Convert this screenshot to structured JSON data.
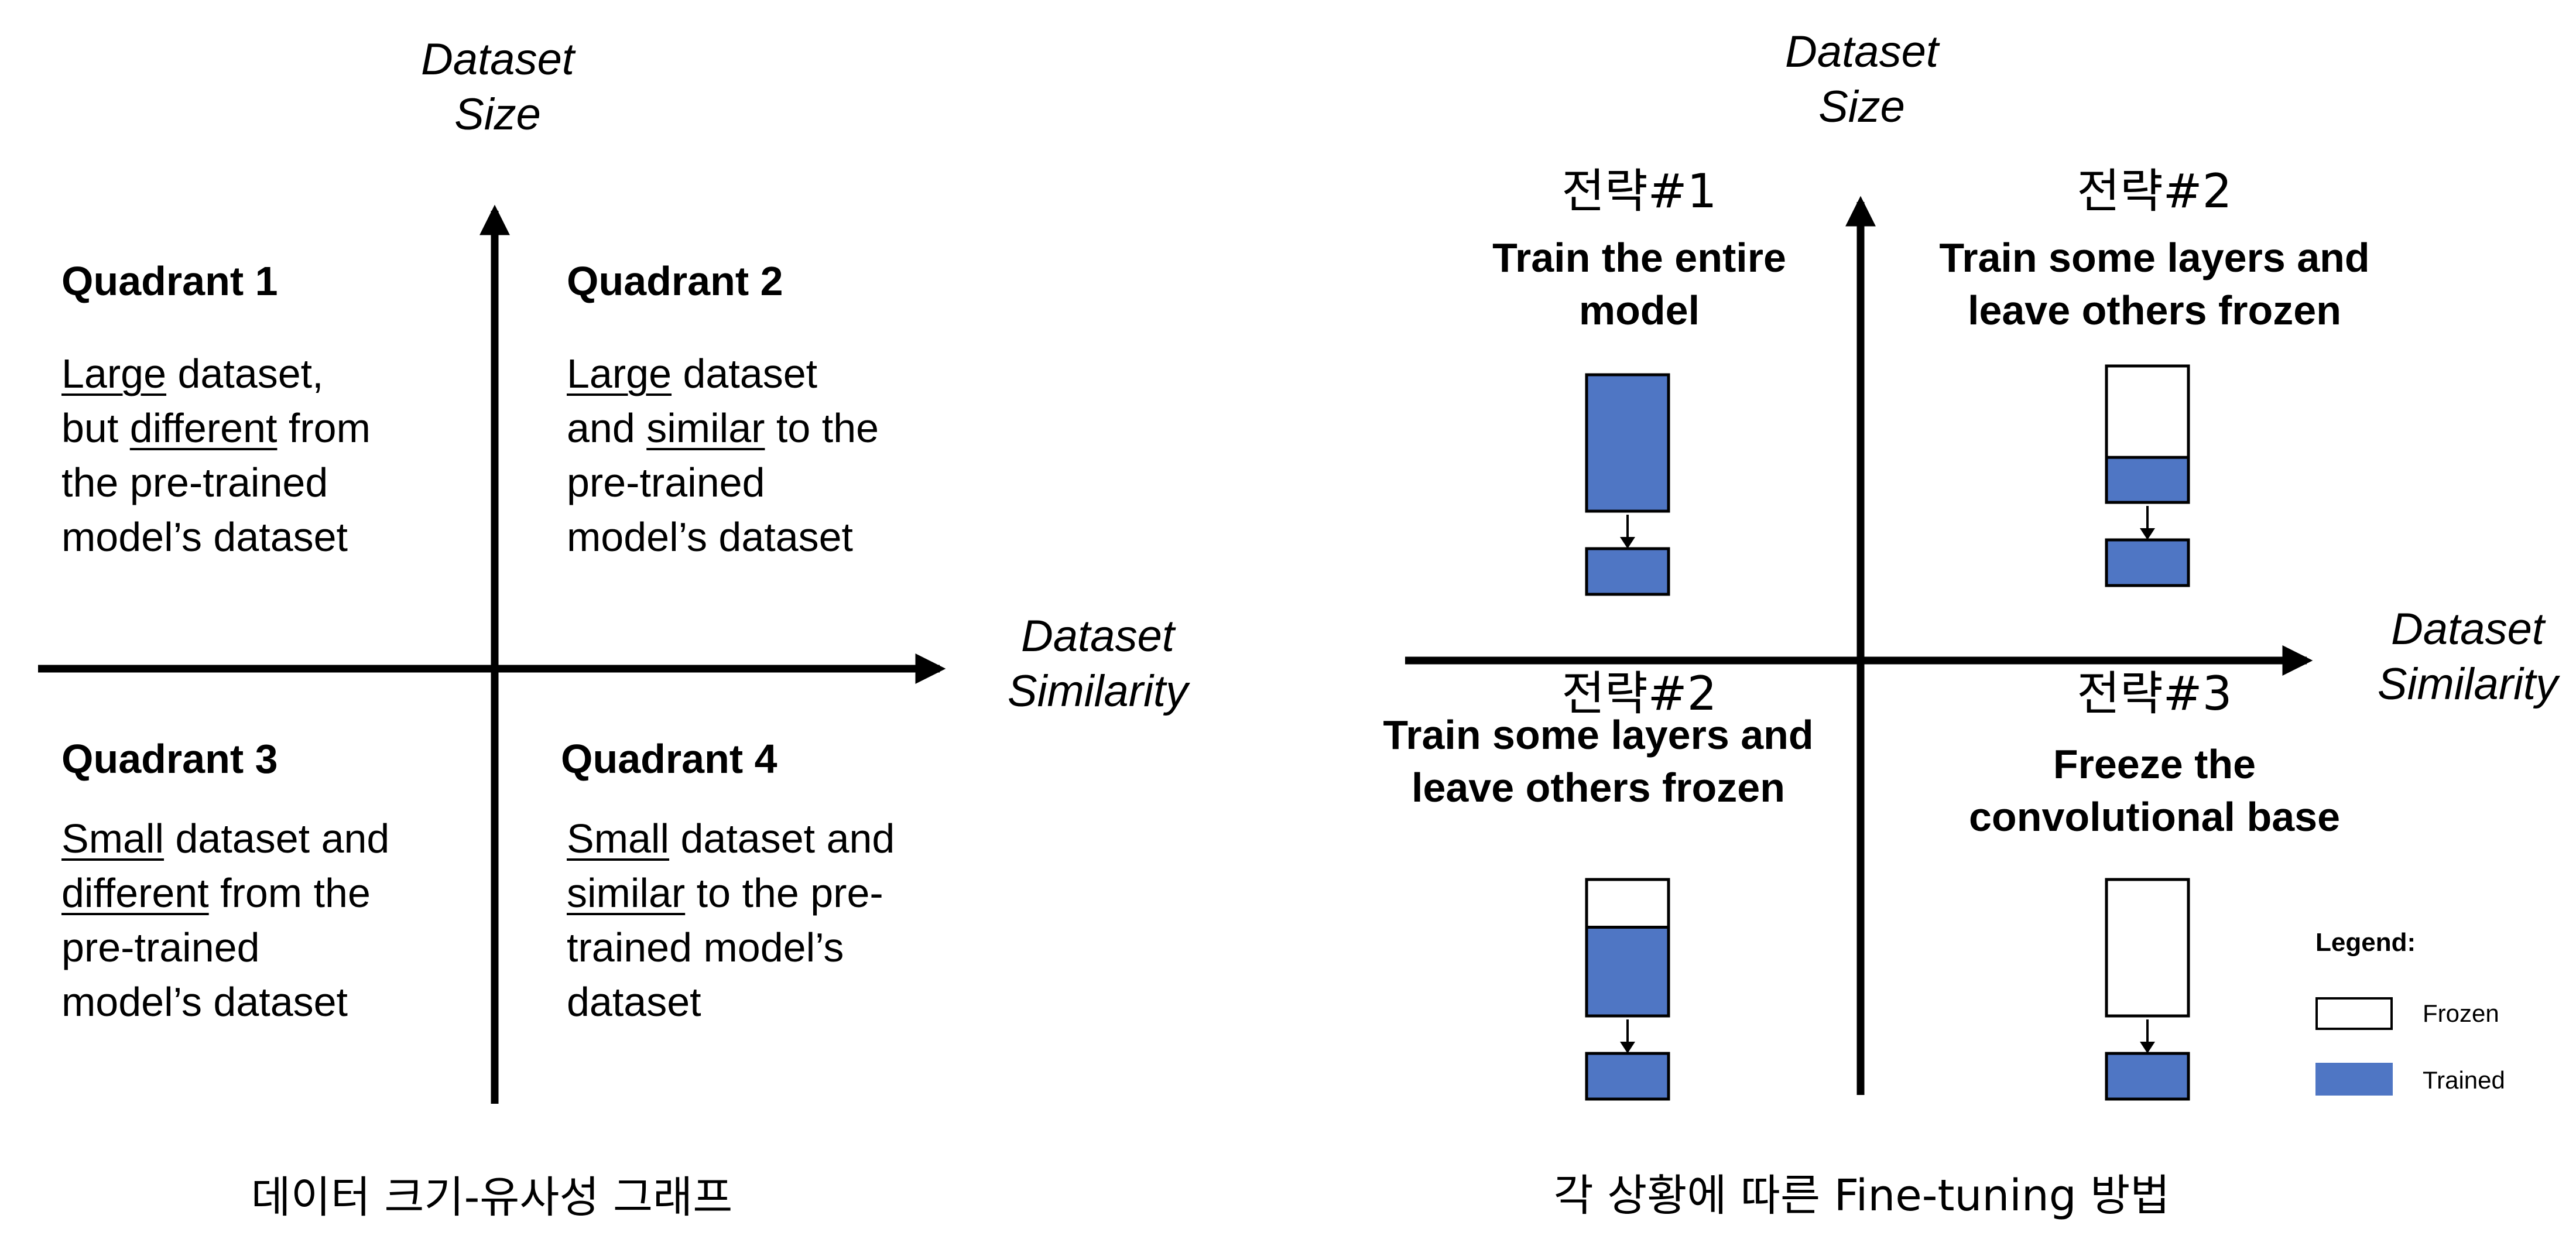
{
  "left_panel": {
    "y_axis_label": [
      "Dataset",
      "Size"
    ],
    "x_axis_label": [
      "Dataset",
      "Similarity"
    ],
    "quadrants": [
      {
        "title": "Quadrant 1",
        "lines": [
          [
            {
              "t": "Large",
              "u": true
            },
            {
              "t": " dataset,"
            }
          ],
          [
            {
              "t": "but "
            },
            {
              "t": "different",
              "u": true
            },
            {
              "t": " from"
            }
          ],
          [
            {
              "t": "the pre-trained"
            }
          ],
          [
            {
              "t": "model’s dataset"
            }
          ]
        ]
      },
      {
        "title": "Quadrant 2",
        "lines": [
          [
            {
              "t": "Large",
              "u": true
            },
            {
              "t": " dataset"
            }
          ],
          [
            {
              "t": "and "
            },
            {
              "t": "similar",
              "u": true
            },
            {
              "t": " to the"
            }
          ],
          [
            {
              "t": "pre-trained"
            }
          ],
          [
            {
              "t": "model’s dataset"
            }
          ]
        ]
      },
      {
        "title": "Quadrant 3",
        "lines": [
          [
            {
              "t": "Small",
              "u": true
            },
            {
              "t": " dataset and"
            }
          ],
          [
            {
              "t": "different",
              "u": true
            },
            {
              "t": " from the"
            }
          ],
          [
            {
              "t": "pre-trained"
            }
          ],
          [
            {
              "t": "model’s dataset"
            }
          ]
        ]
      },
      {
        "title": "Quadrant 4",
        "lines": [
          [
            {
              "t": "Small",
              "u": true
            },
            {
              "t": " dataset and"
            }
          ],
          [
            {
              "t": "similar",
              "u": true
            },
            {
              "t": " to the pre-"
            }
          ],
          [
            {
              "t": "trained model’s"
            }
          ],
          [
            {
              "t": "dataset"
            }
          ]
        ]
      }
    ],
    "caption": "데이터 크기-유사성 그래프"
  },
  "right_panel": {
    "y_axis_label": [
      "Dataset",
      "Size"
    ],
    "x_axis_label": [
      "Dataset",
      "Similarity"
    ],
    "strategies": [
      {
        "label": "전략#1",
        "desc": [
          "Train the entire",
          "model"
        ],
        "top_frozen_fraction": 0.0,
        "bottom": "trained"
      },
      {
        "label": "전략#2",
        "desc": [
          "Train some layers and",
          "leave others frozen"
        ],
        "top_frozen_fraction": 0.67,
        "bottom": "trained"
      },
      {
        "label": "전략#2",
        "desc": [
          "Train some layers and",
          "leave others frozen"
        ],
        "top_frozen_fraction": 0.35,
        "bottom": "trained"
      },
      {
        "label": "전략#3",
        "desc": [
          "Freeze the",
          "convolutional base"
        ],
        "top_frozen_fraction": 1.0,
        "bottom": "trained"
      }
    ],
    "legend": {
      "title": "Legend:",
      "frozen": "Frozen",
      "trained": "Trained"
    },
    "caption": "각 상황에 따른 Fine-tuning 방법"
  },
  "colors": {
    "trained": "#4f76c4",
    "frozen": "#ffffff",
    "stroke": "#000000"
  }
}
